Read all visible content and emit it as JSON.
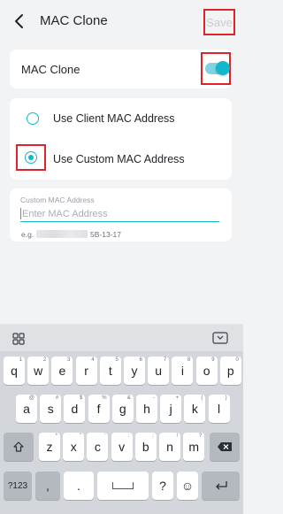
{
  "header": {
    "title": "MAC Clone",
    "save_label": "Save"
  },
  "toggle_card": {
    "label": "MAC Clone",
    "enabled": true
  },
  "options": [
    {
      "label": "Use Client MAC Address",
      "selected": false
    },
    {
      "label": "Use Custom MAC Address",
      "selected": true
    }
  ],
  "mac_field": {
    "caption": "Custom MAC Address",
    "value": "",
    "placeholder": "Enter MAC Address",
    "example_prefix": "e.g.",
    "example_suffix": "5B-13-17"
  },
  "keyboard": {
    "row1": [
      {
        "key": "q",
        "hint": "1"
      },
      {
        "key": "w",
        "hint": "2"
      },
      {
        "key": "e",
        "hint": "3"
      },
      {
        "key": "r",
        "hint": "4"
      },
      {
        "key": "t",
        "hint": "5"
      },
      {
        "key": "y",
        "hint": "6"
      },
      {
        "key": "u",
        "hint": "7"
      },
      {
        "key": "i",
        "hint": "8"
      },
      {
        "key": "o",
        "hint": "9"
      },
      {
        "key": "p",
        "hint": "0"
      }
    ],
    "row2": [
      {
        "key": "a",
        "hint": "@"
      },
      {
        "key": "s",
        "hint": "#"
      },
      {
        "key": "d",
        "hint": "$"
      },
      {
        "key": "f",
        "hint": "%"
      },
      {
        "key": "g",
        "hint": "&"
      },
      {
        "key": "h",
        "hint": "-"
      },
      {
        "key": "j",
        "hint": "+"
      },
      {
        "key": "k",
        "hint": "("
      },
      {
        "key": "l",
        "hint": ")"
      }
    ],
    "row3": [
      {
        "key": "z",
        "hint": "*"
      },
      {
        "key": "x",
        "hint": "\""
      },
      {
        "key": "c",
        "hint": "'"
      },
      {
        "key": "v",
        "hint": ":"
      },
      {
        "key": "b",
        "hint": ";"
      },
      {
        "key": "n",
        "hint": "!"
      },
      {
        "key": "m",
        "hint": "?"
      }
    ],
    "symbols_label": "?123",
    "comma_label": ",",
    "period_label": ".",
    "question_label": "?",
    "emoji_label": "☺"
  },
  "colors": {
    "accent": "#14b6cc",
    "highlight": "#e0222a",
    "background": "#f2f3f5"
  }
}
